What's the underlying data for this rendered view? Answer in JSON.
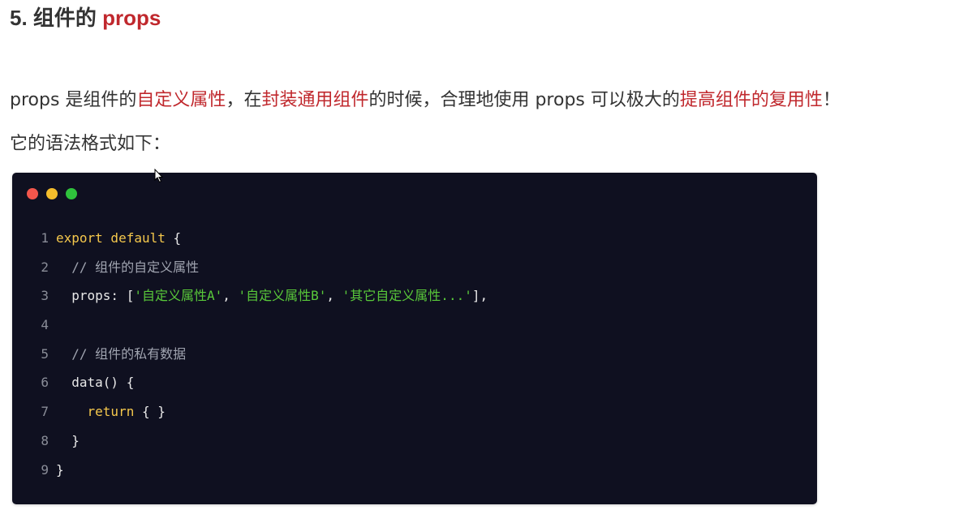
{
  "heading": {
    "prefix": "5. 组件的 ",
    "highlight": "props"
  },
  "paragraph1": {
    "t1": "props 是组件的",
    "r1": "自定义属性",
    "t2": "，在",
    "r2": "封装通用组件",
    "t3": "的时候，合理地使用 props 可以极大的",
    "r3": "提高组件的复用性",
    "t4": "！"
  },
  "paragraph2": {
    "text": "它的语法格式如下："
  },
  "code_window": {
    "colors": {
      "background": "#0f1020",
      "keyword": "#f5c84c",
      "string": "#59c93a",
      "comment": "#a0a4b0"
    },
    "lines": [
      {
        "num": "1",
        "kw1": "export default",
        "rest": " {"
      },
      {
        "num": "2",
        "comment": "  // 组件的自定义属性"
      },
      {
        "num": "3",
        "pre": "  props: [",
        "s1": "'自定义属性A'",
        "sep1": ", ",
        "s2": "'自定义属性B'",
        "sep2": ", ",
        "s3": "'其它自定义属性...'",
        "post": "],"
      },
      {
        "num": "4"
      },
      {
        "num": "5",
        "comment": "  // 组件的私有数据"
      },
      {
        "num": "6",
        "text": "  data() {"
      },
      {
        "num": "7",
        "indent": "    ",
        "kw": "return",
        "rest": " { }"
      },
      {
        "num": "8",
        "text": "  }"
      },
      {
        "num": "9",
        "text": "}"
      }
    ]
  }
}
